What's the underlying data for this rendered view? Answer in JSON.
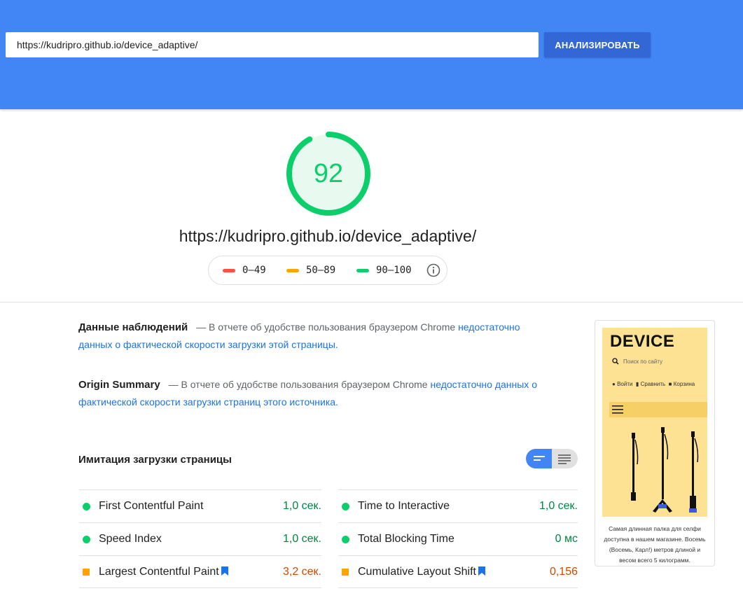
{
  "header": {
    "url_value": "https://kudripro.github.io/device_adaptive/",
    "analyze_label": "АНАЛИЗИРОВАТЬ"
  },
  "score": {
    "value": "92",
    "gauge_fraction": 0.92,
    "color": "#0cce6b"
  },
  "page_url": "https://kudripro.github.io/device_adaptive/",
  "legend": {
    "items": [
      {
        "label": "0–49",
        "color": "#ff4e42"
      },
      {
        "label": "50–89",
        "color": "#ffa400"
      },
      {
        "label": "90–100",
        "color": "#0cce6b"
      }
    ],
    "icon": "info-icon"
  },
  "field_data": {
    "title": "Данные наблюдений",
    "text": "— В отчете об удобстве пользования браузером Chrome",
    "link": "недостаточно данных о фактической скорости загрузки этой страницы."
  },
  "origin_summary": {
    "title": "Origin Summary",
    "text": "— В отчете об удобстве пользования браузером Chrome",
    "link": "недостаточно данных о фактической скорости загрузки страниц этого источника."
  },
  "lab": {
    "title": "Имитация загрузки страницы",
    "toggle_icons": [
      "bars-short-icon",
      "bars-long-icon"
    ]
  },
  "metrics": {
    "left": [
      {
        "name": "First Contentful Paint",
        "value": "1,0 сек.",
        "status": "pass"
      },
      {
        "name": "Speed Index",
        "value": "1,0 сек.",
        "status": "pass"
      },
      {
        "name": "Largest Contentful Paint",
        "value": "3,2 сек.",
        "status": "average"
      }
    ],
    "right": [
      {
        "name": "Time to Interactive",
        "value": "1,0 сек.",
        "status": "pass"
      },
      {
        "name": "Total Blocking Time",
        "value": "0 мс",
        "status": "pass"
      },
      {
        "name": "Cumulative Layout Shift",
        "value": "0,156",
        "status": "average"
      }
    ],
    "colors": {
      "pass": "#0cce6b",
      "average": "#ffa400",
      "pass_text": "#018642",
      "average_text": "#d04900"
    }
  },
  "screenshot": {
    "brand": "DEVICE",
    "search_placeholder": "Поиск по сайту",
    "nav_login": "Войти",
    "nav_compare": "Сравнить",
    "nav_cart": "Корзина",
    "caption": "Самая длинная палка для селфи доступна в нашем магазине. Восемь (Восемь, Карл!) метров длиной и весом всего 5 килограмм."
  }
}
